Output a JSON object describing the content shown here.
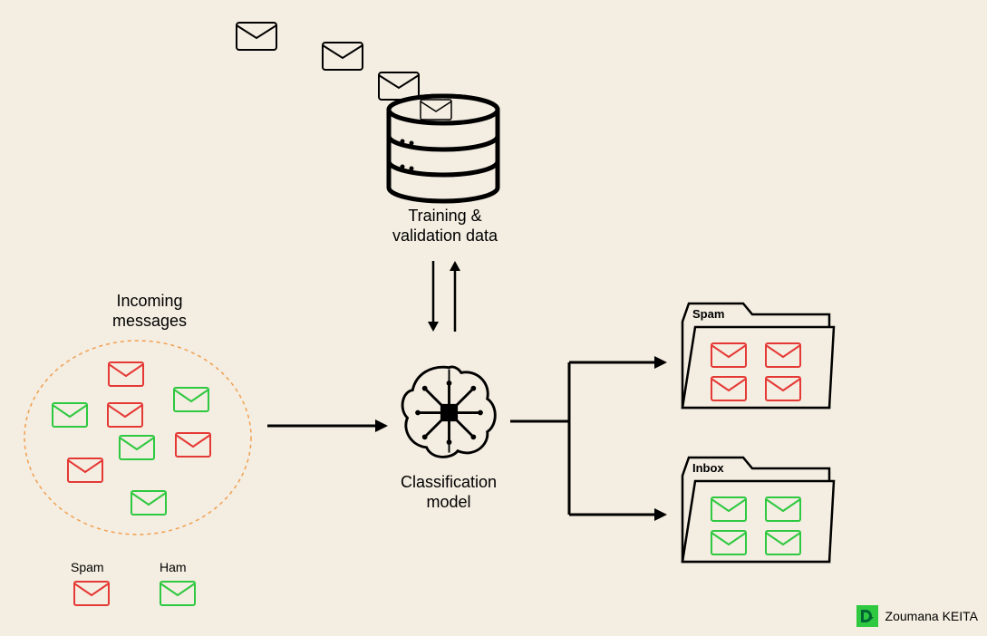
{
  "labels": {
    "training": "Training &\nvalidation data",
    "incoming": "Incoming\nmessages",
    "classification": "Classification\nmodel",
    "spam_legend": "Spam",
    "ham_legend": "Ham",
    "spam_folder": "Spam",
    "inbox_folder": "Inbox"
  },
  "attribution": {
    "name": "Zoumana KEITA",
    "logo": "DC"
  },
  "colors": {
    "spam": "#e53935",
    "ham": "#2ec940",
    "black": "#000000",
    "orange_dash": "#f0a050"
  }
}
